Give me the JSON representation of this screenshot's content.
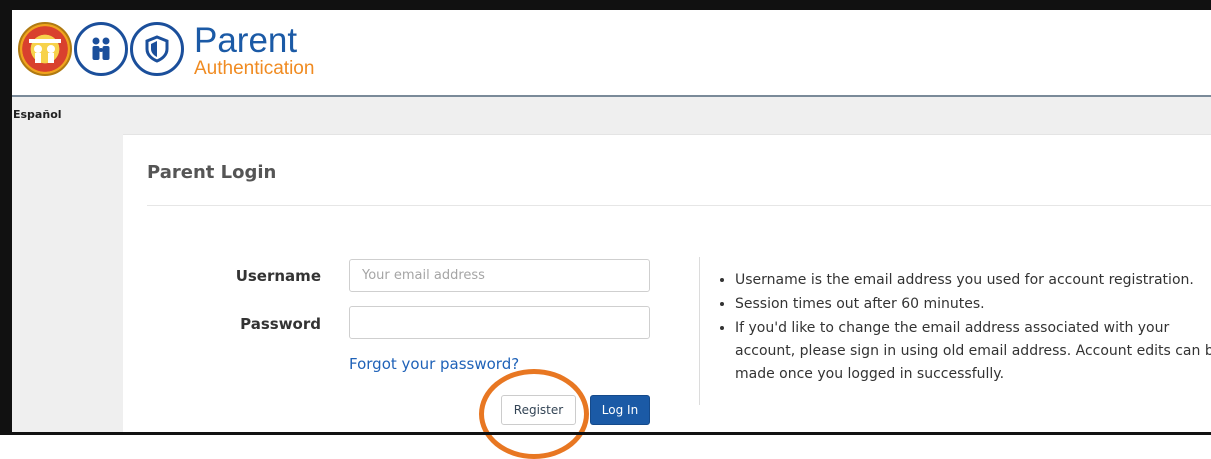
{
  "header": {
    "brand_title": "Parent",
    "brand_subtitle": "Authentication",
    "logos": [
      "district-seal-icon",
      "parent-family-icon",
      "security-shield-icon"
    ],
    "colors": {
      "brand_blue": "#1b5aa6",
      "brand_orange": "#f08b21"
    }
  },
  "language_link": "Español",
  "login": {
    "title": "Parent Login",
    "username_label": "Username",
    "username_placeholder": "Your email address",
    "username_value": "",
    "password_label": "Password",
    "password_value": "",
    "forgot_link": "Forgot your password?",
    "register_label": "Register",
    "login_label": "Log In",
    "highlight_color": "#e87722"
  },
  "notes": [
    "Username is the email address you used for account registration.",
    "Session times out after 60 minutes.",
    "If you'd like to change the email address associated with your account, please sign in using old email address. Account edits can be made once you logged in successfully."
  ]
}
